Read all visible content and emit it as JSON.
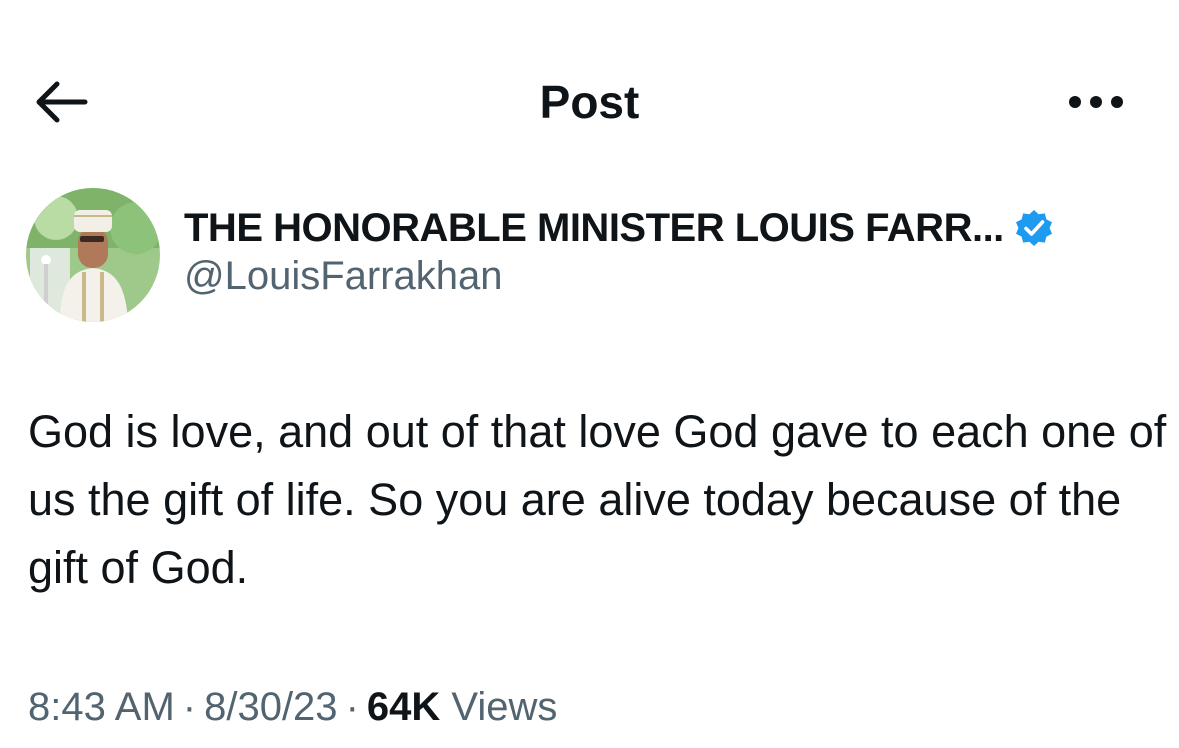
{
  "header": {
    "title": "Post",
    "back_icon": "arrow-left-icon",
    "more_icon": "more-horizontal-icon"
  },
  "author": {
    "display_name": "THE HONORABLE MINISTER LOUIS FARR...",
    "handle": "@LouisFarrakhan",
    "verified_icon": "verified-badge-icon",
    "verified_color": "#1d9bf0"
  },
  "post": {
    "text": "God is love, and out of that love God gave to each one of us the gift of life. So you are alive today because of the gift of God."
  },
  "meta": {
    "time": "8:43 AM",
    "separator": "·",
    "date": "8/30/23",
    "views_count": "64K",
    "views_label": "Views"
  },
  "colors": {
    "text_primary": "#0f1419",
    "text_secondary": "#536471",
    "accent": "#1d9bf0",
    "background": "#ffffff"
  }
}
